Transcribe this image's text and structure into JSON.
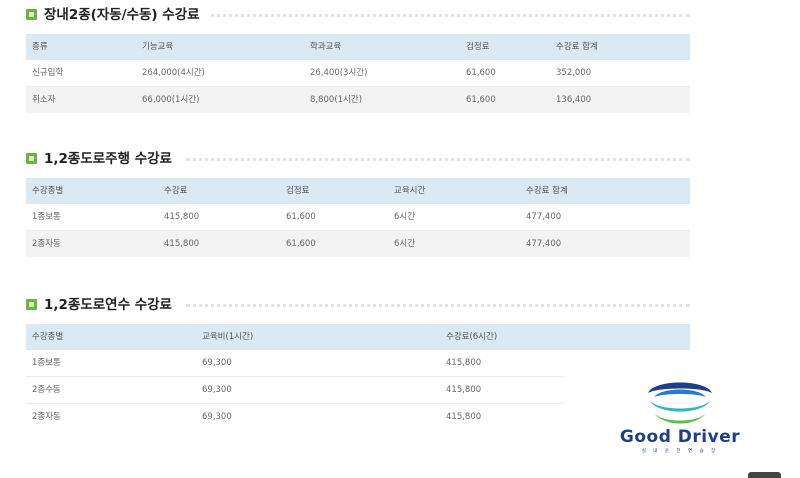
{
  "sections": {
    "indoor_class2": {
      "title": "장내2종(자동/수동) 수강료",
      "headers": [
        "종류",
        "기능교육",
        "학과교육",
        "검정료",
        "수강료 합계"
      ],
      "rows": [
        [
          "신규입학",
          "264,000(4시간)",
          "26,400(3시간)",
          "61,600",
          "352,000"
        ],
        [
          "취소자",
          "66,000(1시간)",
          "8,800(1시간)",
          "61,600",
          "136,400"
        ]
      ]
    },
    "road_driving": {
      "title": "1,2종도로주행 수강료",
      "headers": [
        "수강종별",
        "수강료",
        "검정료",
        "교육시간",
        "수강료 합계"
      ],
      "rows": [
        [
          "1종보통",
          "415,800",
          "61,600",
          "6시간",
          "477,400"
        ],
        [
          "2종자동",
          "415,800",
          "61,600",
          "6시간",
          "477,400"
        ]
      ]
    },
    "road_practice": {
      "title": "1,2종도로연수 수강료",
      "headers": [
        "수강종별",
        "교육비(1시간)",
        "수강료(6시간)"
      ],
      "rows": [
        [
          "1종보통",
          "69,300",
          "415,800"
        ],
        [
          "2종수동",
          "69,300",
          "415,800"
        ],
        [
          "2종자동",
          "69,300",
          "415,800"
        ]
      ]
    }
  },
  "logo": {
    "name": "Good Driver",
    "subtitle": "실 내 운 전 연 습 장",
    "colors": {
      "navy": "#1d3f8a",
      "blue": "#2a78c8",
      "teal": "#2bb7c4",
      "green": "#5cc04a"
    }
  }
}
